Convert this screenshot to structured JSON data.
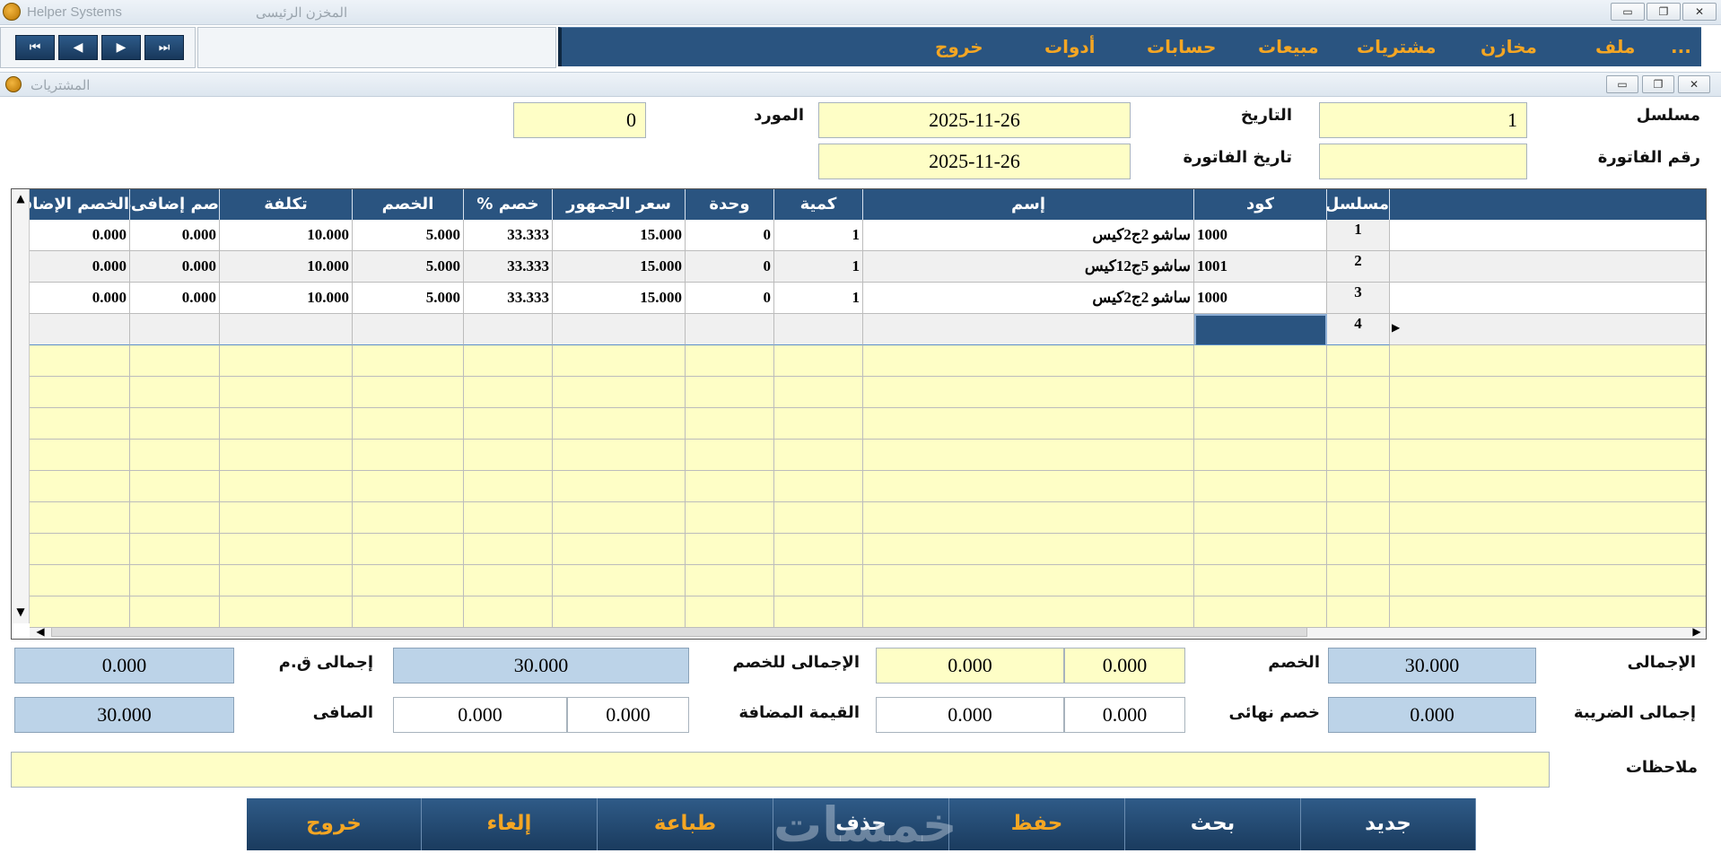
{
  "app_window": {
    "title": "Helper Systems",
    "subtitle": "المخزن الرئيسى",
    "icons": [
      "app-logo-icon",
      "minimize-icon",
      "restore-icon",
      "close-icon"
    ]
  },
  "navigation": {
    "first": "⏮",
    "prev": "◀",
    "next": "▶",
    "last": "⏭"
  },
  "menu": {
    "items": [
      "...",
      "ملف",
      "مخازن",
      "مشتريات",
      "مبيعات",
      "حسابات",
      "أدوات",
      "خروج"
    ]
  },
  "child_window": {
    "title": "المشتريات"
  },
  "header_form": {
    "serial_label": "مسلسل",
    "serial_value": "1",
    "date_label": "التاريخ",
    "date_value": "2025-11-26",
    "supplier_label": "المورد",
    "supplier_value": "0",
    "invoice_no_label": "رقم الفاتورة",
    "invoice_no_value": "",
    "invoice_date_label": "تاريخ الفاتورة",
    "invoice_date_value": "2025-11-26"
  },
  "grid": {
    "columns": [
      "مسلسل",
      "كود",
      "إسم",
      "كمية",
      "وحدة",
      "سعر الجمهور",
      "خصم %",
      "الخصم",
      "تكلفة",
      "صم إضافى%",
      "الخصم الإضافى"
    ],
    "rows": [
      {
        "serial": "1",
        "code": "1000",
        "name": "ساشو 2ج2كيس",
        "qty": "1",
        "unit": "0",
        "price": "15.000",
        "disc_pct": "33.333",
        "disc": "5.000",
        "cost": "10.000",
        "extra_pct": "0.000",
        "extra_disc": "0.000"
      },
      {
        "serial": "2",
        "code": "1001",
        "name": "ساشو 5ج12كيس",
        "qty": "1",
        "unit": "0",
        "price": "15.000",
        "disc_pct": "33.333",
        "disc": "5.000",
        "cost": "10.000",
        "extra_pct": "0.000",
        "extra_disc": "0.000"
      },
      {
        "serial": "3",
        "code": "1000",
        "name": "ساشو 2ج2كيس",
        "qty": "1",
        "unit": "0",
        "price": "15.000",
        "disc_pct": "33.333",
        "disc": "5.000",
        "cost": "10.000",
        "extra_pct": "0.000",
        "extra_disc": "0.000"
      },
      {
        "serial": "4",
        "code": "",
        "name": "",
        "qty": "",
        "unit": "",
        "price": "",
        "disc_pct": "",
        "disc": "",
        "cost": "",
        "extra_pct": "",
        "extra_disc": ""
      }
    ],
    "row_indicator": "▶",
    "scroll_up": "▲",
    "scroll_down": "▼",
    "scroll_left": "◀",
    "scroll_right": "▶"
  },
  "totals": {
    "total_label": "الإجمالى",
    "total_value": "30.000",
    "discount_label": "الخصم",
    "discount_pct": "0.000",
    "discount_value": "0.000",
    "total_after_discount_label": "الإجمالى للخصم",
    "total_after_discount_value": "30.000",
    "total_qm_label": "إجمالى ق.م",
    "total_qm_value": "0.000",
    "total_tax_label": "إجمالى الضريبة",
    "total_tax_value": "0.000",
    "final_discount_label": "خصم نهائى",
    "final_discount_pct": "0.000",
    "final_discount_value": "0.000",
    "vat_label": "القيمة المضافة",
    "vat_pct": "0.000",
    "vat_value": "0.000",
    "net_label": "الصافى",
    "net_value": "30.000",
    "notes_label": "ملاحظات",
    "notes_value": ""
  },
  "actions": {
    "new": "جديد",
    "search": "بحث",
    "save": "حفظ",
    "delete": "حذف",
    "print": "طباعة",
    "cancel": "إلغاء",
    "exit": "خروج"
  },
  "watermark": "خمسات",
  "colors": {
    "menu_bg": "#2a5480",
    "menu_text": "#f5a623",
    "field_yellow": "#fefec6",
    "field_blue": "#bcd3e8",
    "header_bg": "#2a5480"
  }
}
